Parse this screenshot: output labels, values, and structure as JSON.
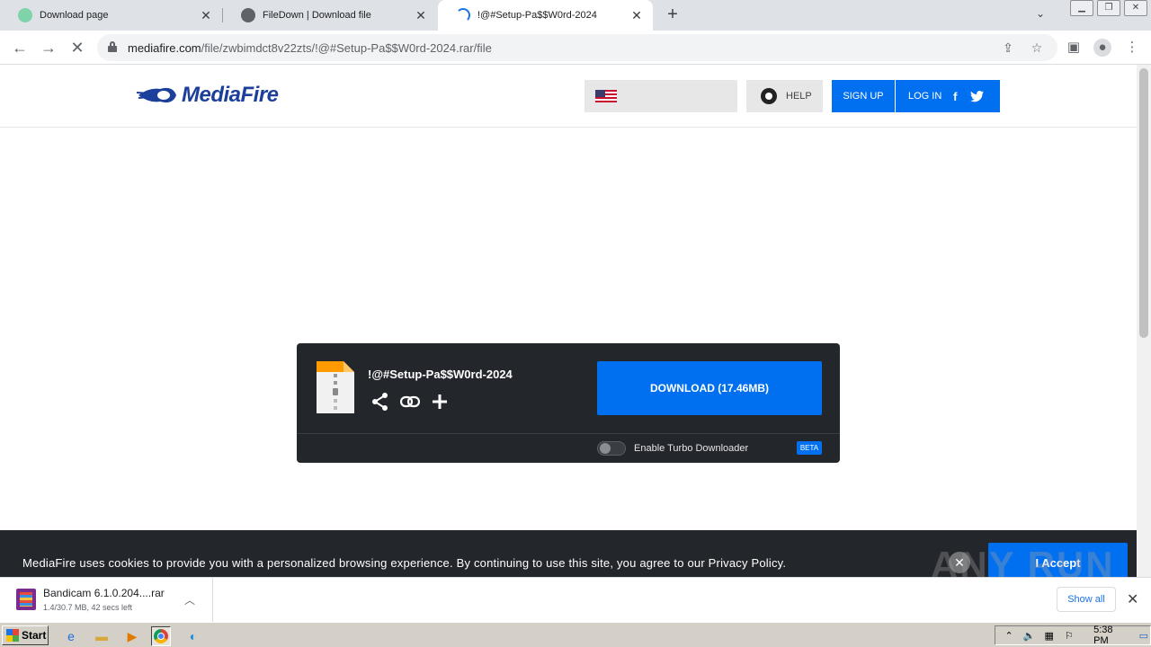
{
  "browser": {
    "tabs": [
      {
        "title": "Download page",
        "active": false
      },
      {
        "title": "FileDown | Download file",
        "active": false
      },
      {
        "title": "!@#Setup-Pa$$W0rd-2024",
        "active": true
      }
    ],
    "new_tab": "+",
    "url_host": "mediafire.com",
    "url_path": "/file/zwbimdct8v22zts/!@#Setup-Pa$$W0rd-2024.rar/file"
  },
  "site": {
    "logo_text": "MediaFire",
    "help_label": "HELP",
    "signup_label": "SIGN UP",
    "login_label": "LOG IN",
    "facebook": "f",
    "colors": {
      "accent": "#0070f0",
      "dark": "#23262b",
      "logo": "#1b3f9a"
    }
  },
  "download": {
    "file_name": "!@#Setup-Pa$$W0rd-2024",
    "button_label": "DOWNLOAD (17.46MB)",
    "turbo_label": "Enable Turbo Downloader",
    "beta_label": "BETA",
    "turbo_enabled": false
  },
  "cookie": {
    "text": "MediaFire uses cookies to provide you with a personalized browsing experience. By continuing to use this site, you agree to our Privacy Policy.",
    "accept_label": "I Accept"
  },
  "watermark": {
    "text": "ANY RUN"
  },
  "shelf": {
    "item_name": "Bandicam 6.1.0.204....rar",
    "item_status": "1.4/30.7 MB, 42 secs left",
    "show_all": "Show all"
  },
  "taskbar": {
    "start_label": "Start",
    "clock": "5:38 PM"
  }
}
